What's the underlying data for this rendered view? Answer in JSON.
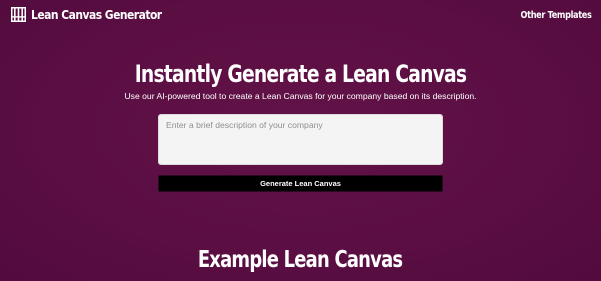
{
  "header": {
    "brand_title": "Lean Canvas Generator",
    "brand_icon": "canvas-columns-icon",
    "nav_link": "Other Templates"
  },
  "hero": {
    "title": "Instantly Generate a Lean Canvas",
    "subtitle": "Use our AI-powered tool to create a Lean Canvas for your company based on its description."
  },
  "form": {
    "description_placeholder": "Enter a brief description of your company",
    "description_value": "",
    "generate_label": "Generate Lean Canvas"
  },
  "example": {
    "title": "Example Lean Canvas"
  },
  "colors": {
    "background": "#5e0f45",
    "input_background": "#f4f4f4",
    "button_background": "#000000",
    "text": "#ffffff"
  }
}
